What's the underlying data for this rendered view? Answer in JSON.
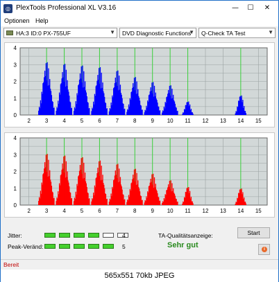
{
  "window": {
    "title": "PlexTools Professional XL V3.16",
    "icon_letter": "◎"
  },
  "menu": [
    "Optionen",
    "Help"
  ],
  "toolbar": {
    "drive": "HA:3 ID:0  PX-755UF",
    "function": "DVD Diagnostic Functions",
    "test": "Q-Check  TA Test"
  },
  "chart_data": [
    {
      "type": "bar",
      "series": [
        {
          "name": "",
          "color": "#0000ff"
        }
      ],
      "x_ticks": [
        "2",
        "3",
        "4",
        "5",
        "6",
        "7",
        "8",
        "9",
        "10",
        "11",
        "12",
        "13",
        "14",
        "15"
      ],
      "y_ticks": [
        "0",
        "0.5",
        "1",
        "1.5",
        "2",
        "2.5",
        "3",
        "3.5",
        "4"
      ],
      "xlim": [
        1.5,
        15.5
      ],
      "ylim": [
        0,
        4
      ],
      "green_lines": [
        3,
        4,
        5,
        6,
        7,
        8,
        9,
        10,
        11,
        14
      ],
      "peaks": [
        {
          "center": 3.0,
          "height": 3.2
        },
        {
          "center": 4.0,
          "height": 3.1
        },
        {
          "center": 5.0,
          "height": 3.0
        },
        {
          "center": 6.0,
          "height": 2.9
        },
        {
          "center": 7.0,
          "height": 2.7
        },
        {
          "center": 8.0,
          "height": 2.3
        },
        {
          "center": 9.0,
          "height": 2.0
        },
        {
          "center": 10.0,
          "height": 1.8
        },
        {
          "center": 11.0,
          "height": 0.9
        },
        {
          "center": 14.0,
          "height": 1.3
        }
      ],
      "grid": true
    },
    {
      "type": "bar",
      "series": [
        {
          "name": "",
          "color": "#ff0000"
        }
      ],
      "x_ticks": [
        "2",
        "3",
        "4",
        "5",
        "6",
        "7",
        "8",
        "9",
        "10",
        "11",
        "12",
        "13",
        "14",
        "15"
      ],
      "y_ticks": [
        "0",
        "0.5",
        "1",
        "1.5",
        "2",
        "2.5",
        "3",
        "3.5",
        "4"
      ],
      "xlim": [
        1.5,
        15.5
      ],
      "ylim": [
        0,
        4
      ],
      "green_lines": [
        3,
        4,
        5,
        6,
        7,
        8,
        9,
        10,
        11,
        14
      ],
      "peaks": [
        {
          "center": 3.0,
          "height": 3.1
        },
        {
          "center": 4.0,
          "height": 3.0
        },
        {
          "center": 5.0,
          "height": 2.9
        },
        {
          "center": 6.0,
          "height": 2.7
        },
        {
          "center": 7.0,
          "height": 2.5
        },
        {
          "center": 8.0,
          "height": 2.2
        },
        {
          "center": 9.0,
          "height": 1.9
        },
        {
          "center": 10.0,
          "height": 1.5
        },
        {
          "center": 11.0,
          "height": 1.2
        },
        {
          "center": 14.0,
          "height": 1.1
        }
      ],
      "grid": true
    }
  ],
  "metrics": {
    "jitter_label": "Jitter:",
    "jitter_value": "4",
    "jitter_level": 4,
    "peak_label": "Peak-Veränd:",
    "peak_value": "5",
    "peak_level": 5,
    "segments": 5,
    "quality_label": "TA-Qualitätsanzeige:",
    "quality_value": "Sehr gut",
    "quality_color": "#2a8a1f"
  },
  "buttons": {
    "start": "Start"
  },
  "status": "Bereit",
  "caption": "565x551  70kb  JPEG"
}
